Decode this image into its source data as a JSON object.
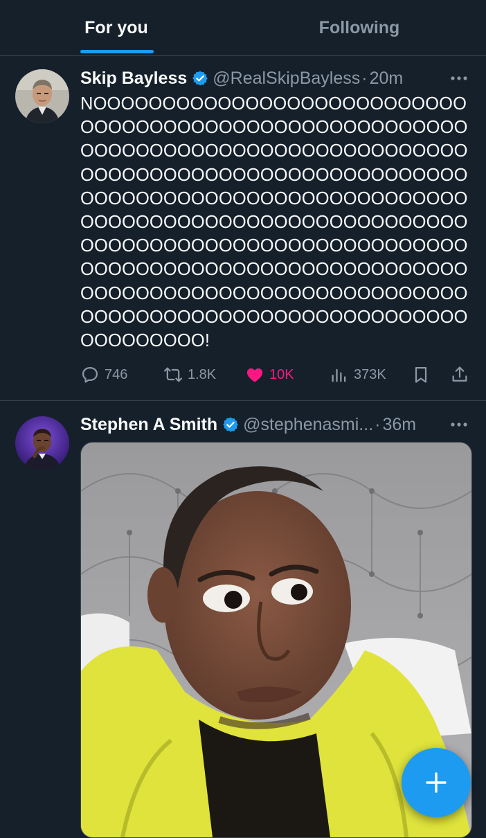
{
  "tabs": [
    {
      "label": "For you",
      "active": true
    },
    {
      "label": "Following",
      "active": false
    }
  ],
  "colors": {
    "background": "#15202b",
    "accent": "#1d9bf0",
    "like": "#f91880",
    "muted": "#8b98a5",
    "divider": "#38444d"
  },
  "tweets": [
    {
      "author": "Skip Bayless",
      "handle": "@RealSkipBayless",
      "separator": "·",
      "time": "20m",
      "verified": true,
      "text": "NOOOOOOOOOOOOOOOOOOOOOOOOOOO\nOOOOOOOOOOOOOOOOOOOOOOOOOOOO\nOOOOOOOOOOOOOOOOOOOOOOOOOOOO\nOOOOOOOOOOOOOOOOOOOOOOOOOOOO\nOOOOOOOOOOOOOOOOOOOOOOOOOOOO\nOOOOOOOOOOOOOOOOOOOOOOOOOOOO\nOOOOOOOOOOOOOOOOOOOOOOOOOOOO\nOOOOOOOOOOOOOOOOOOOOOOOOOOOO\nOOOOOOOOOOOOOOOOOOOOOOOOOOOO\nOOOOOOOOOOOOOOOOOOOOOOOOOOOO\nOOOOOOOOO!",
      "replies": "746",
      "reposts": "1.8K",
      "likes": "10K",
      "views": "373K",
      "liked": true,
      "icons": [
        "reply-icon",
        "repost-icon",
        "heart-icon",
        "views-icon",
        "bookmark-icon",
        "share-icon"
      ]
    },
    {
      "author": "Stephen A Smith",
      "handle": "@stephenasmi...",
      "separator": "·",
      "time": "36m",
      "verified": true,
      "media": "photo of a man in a yellow hoodie looking sideways in front of a gray tufted headboard"
    }
  ],
  "fab": {
    "icon": "plus-icon"
  }
}
